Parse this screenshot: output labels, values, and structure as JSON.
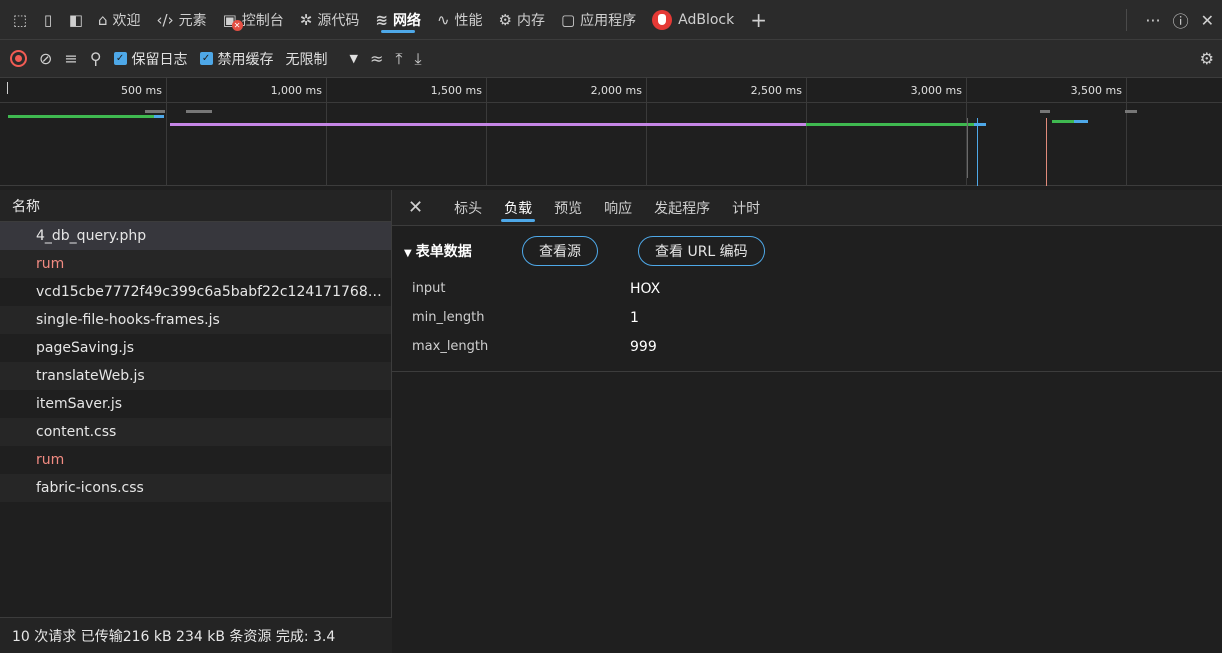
{
  "top_tabs": {
    "welcome": "欢迎",
    "elements": "元素",
    "console": "控制台",
    "sources": "源代码",
    "network": "网络",
    "performance": "性能",
    "memory": "内存",
    "application": "应用程序",
    "adblock": "AdBlock"
  },
  "toolbar": {
    "preserve_log": "保留日志",
    "disable_cache": "禁用缓存",
    "throttling": "无限制"
  },
  "timeline": {
    "ticks": [
      "500 ms",
      "1,000 ms",
      "1,500 ms",
      "2,000 ms",
      "2,500 ms",
      "3,000 ms",
      "3,500 ms"
    ]
  },
  "requests": {
    "header": "名称",
    "items": [
      {
        "name": "4_db_query.php",
        "status": "selected"
      },
      {
        "name": "rum",
        "status": "error"
      },
      {
        "name": "vcd15cbe7772f49c399c6a5babf22c124171768…",
        "status": "normal"
      },
      {
        "name": "single-file-hooks-frames.js",
        "status": "normal"
      },
      {
        "name": "pageSaving.js",
        "status": "normal"
      },
      {
        "name": "translateWeb.js",
        "status": "normal"
      },
      {
        "name": "itemSaver.js",
        "status": "normal"
      },
      {
        "name": "content.css",
        "status": "normal"
      },
      {
        "name": "rum",
        "status": "error"
      },
      {
        "name": "fabric-icons.css",
        "status": "normal"
      }
    ],
    "footer": "10 次请求  已传输216 kB  234 kB 条资源  完成: 3.4"
  },
  "detail": {
    "tabs": [
      "标头",
      "负载",
      "预览",
      "响应",
      "发起程序",
      "计时"
    ],
    "active_tab": "负载",
    "section_title": "表单数据",
    "view_source": "查看源",
    "view_url_encoded": "查看 URL 编码",
    "fields": [
      {
        "key": "input",
        "value": "HOX"
      },
      {
        "key": "min_length",
        "value": "1"
      },
      {
        "key": "max_length",
        "value": "999"
      }
    ]
  },
  "colors": {
    "accent": "#4ea8e8",
    "record": "#f25c54",
    "error_text": "#f28b82"
  }
}
